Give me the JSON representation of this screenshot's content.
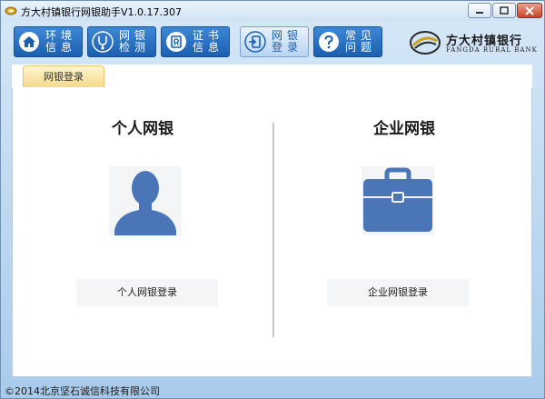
{
  "window": {
    "title": "方大村镇银行网银助手V1.0.17.307"
  },
  "toolbar": {
    "items": [
      {
        "label": "环境信息",
        "icon": "home-icon",
        "active": false
      },
      {
        "label": "网银检测",
        "icon": "stethoscope-icon",
        "active": false
      },
      {
        "label": "证书信息",
        "icon": "certificate-icon",
        "active": false
      },
      {
        "label": "网银登录",
        "icon": "login-icon",
        "active": true
      },
      {
        "label": "常见问题",
        "icon": "question-icon",
        "active": false
      }
    ]
  },
  "logo": {
    "name_cn": "方大村镇银行",
    "name_en": "FANGDA RURAL BANK"
  },
  "tabs": [
    {
      "label": "网银登录",
      "active": true
    }
  ],
  "personal": {
    "title": "个人网银",
    "icon": "person-icon",
    "button_label": "个人网银登录"
  },
  "business": {
    "title": "企业网银",
    "icon": "briefcase-icon",
    "button_label": "企业网银登录"
  },
  "status": {
    "copyright": "©2014北京坚石诚信科技有限公司"
  },
  "colors": {
    "accent": "#1b5fb0",
    "icon_blue": "#4a76b8",
    "tab_gold": "#f4d98a"
  }
}
